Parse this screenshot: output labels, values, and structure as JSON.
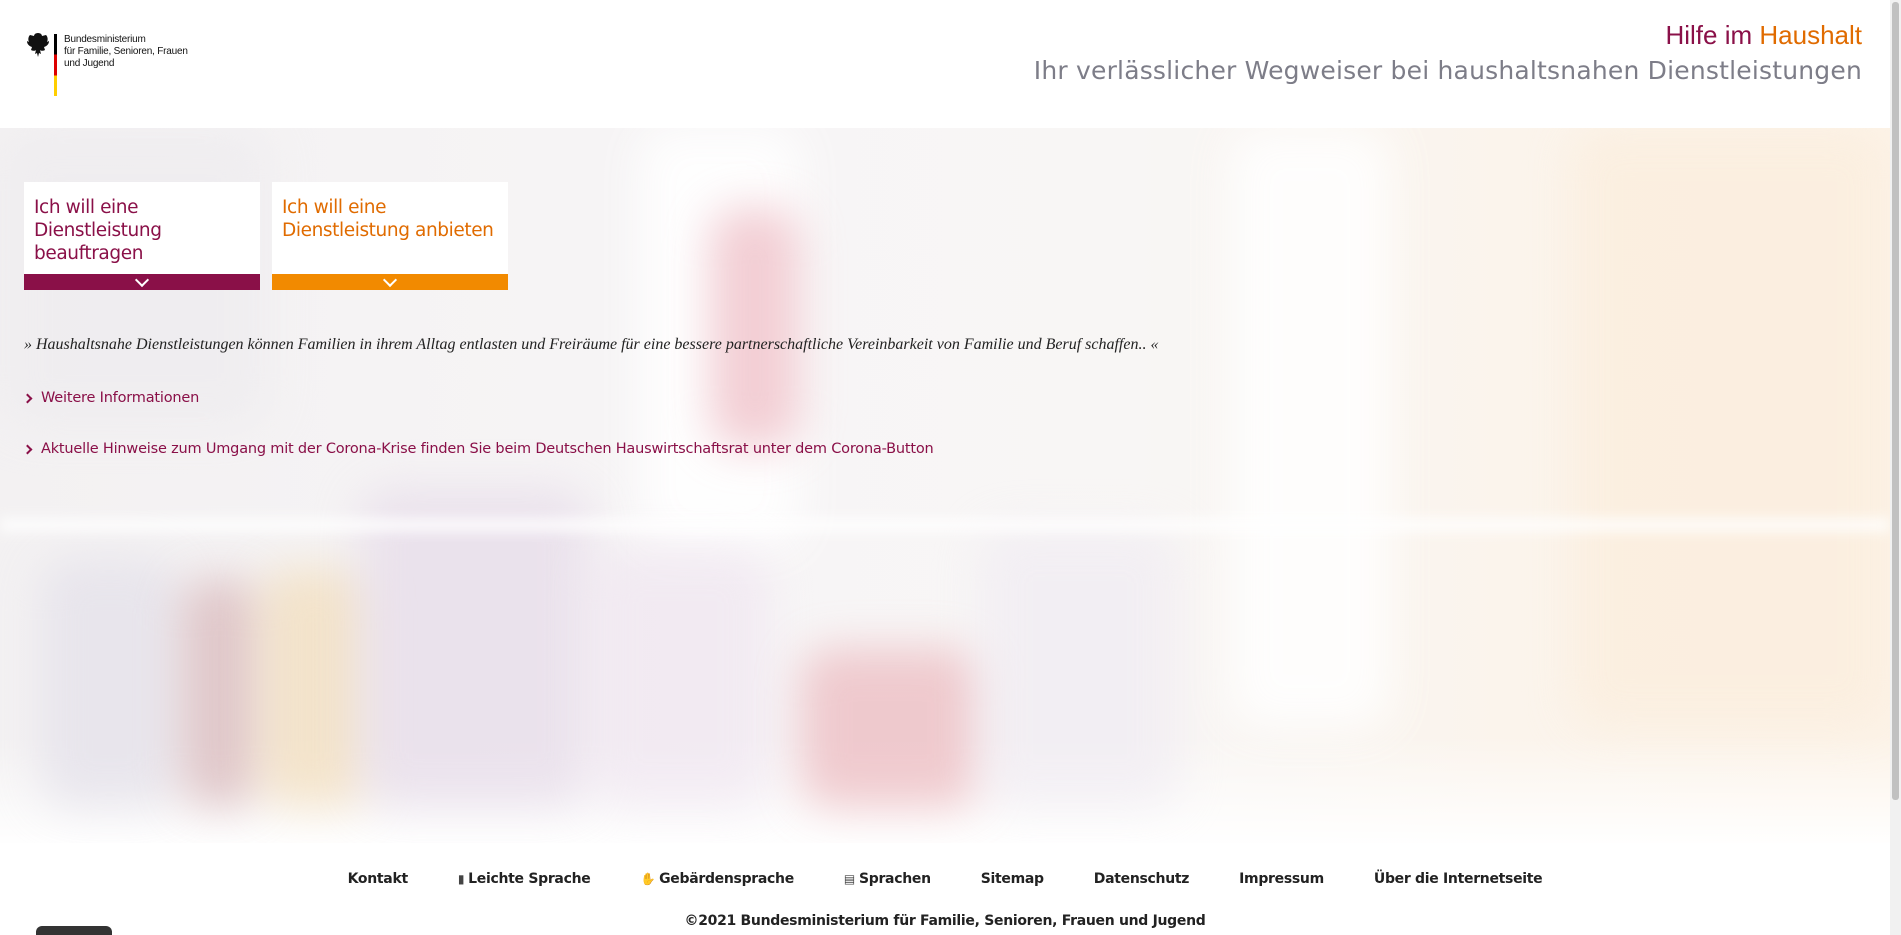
{
  "header": {
    "ministry_lines": [
      "Bundesministerium",
      "für Familie, Senioren, Frauen",
      "und Jugend"
    ],
    "title_part1": "Hilfe im",
    "title_part2": "Haushalt",
    "subtitle": "Ihr verlässlicher Wegweiser bei haushaltsnahen Dienstleistungen"
  },
  "tiles": [
    {
      "label": "Ich will eine Dienstleistung beauftragen",
      "icon": "chevron-down-icon"
    },
    {
      "label": "Ich will eine Dienstleistung anbieten",
      "icon": "chevron-down-icon"
    }
  ],
  "quote": "» Haushaltsnahe Dienstleistungen können Familien in ihrem Alltag entlasten und Freiräume für eine bessere partnerschaftliche Vereinbarkeit von Familie und Beruf schaffen.. «",
  "links": [
    {
      "label": "Weitere Informationen",
      "icon": "chevron-right-icon"
    },
    {
      "label": "Aktuelle Hinweise zum Umgang mit der Corona-Krise finden Sie beim Deutschen Hauswirtschaftsrat unter dem Corona-Button",
      "icon": "chevron-right-icon"
    }
  ],
  "footer": {
    "nav": [
      {
        "label": "Kontakt",
        "icon": ""
      },
      {
        "label": "Leichte Sprache",
        "icon": "easy-language-icon"
      },
      {
        "label": "Gebärdensprache",
        "icon": "sign-language-icon"
      },
      {
        "label": "Sprachen",
        "icon": "languages-icon"
      },
      {
        "label": "Sitemap",
        "icon": ""
      },
      {
        "label": "Datenschutz",
        "icon": ""
      },
      {
        "label": "Impressum",
        "icon": ""
      },
      {
        "label": "Über die Internetseite",
        "icon": ""
      }
    ],
    "copyright": "©2021 Bundesministerium für Familie, Senioren, Frauen und Jugend"
  },
  "colors": {
    "brand_purple": "#8a1048",
    "brand_orange": "#e06b00",
    "subtitle_grey": "#7d7d88"
  }
}
